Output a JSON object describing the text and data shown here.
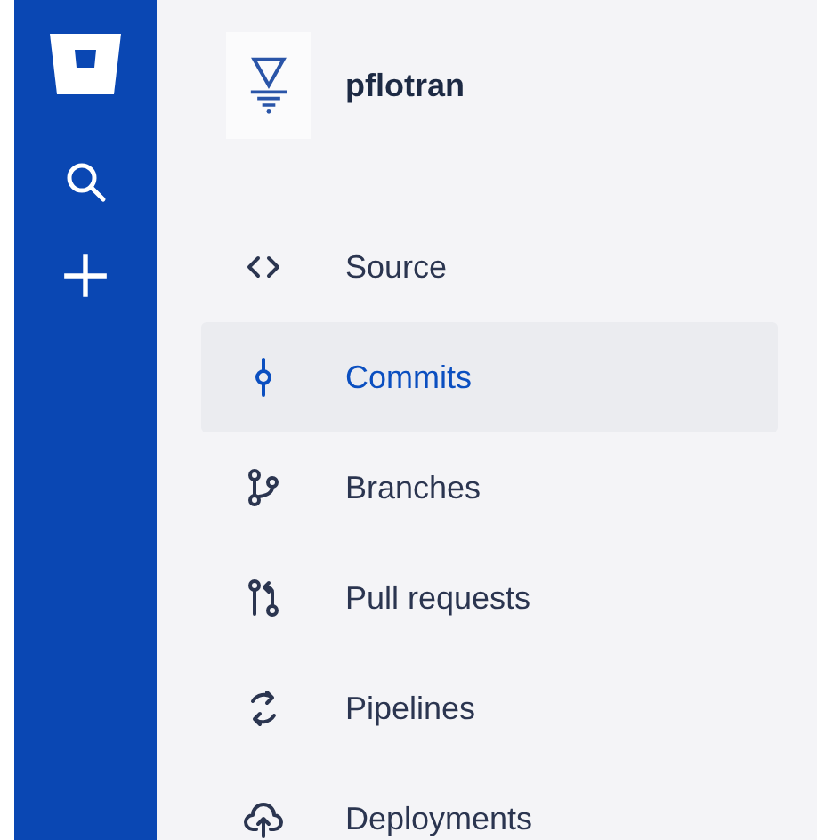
{
  "repository": {
    "name": "pflotran"
  },
  "nav_items": [
    {
      "label": "Source",
      "kind": "source",
      "selected": false
    },
    {
      "label": "Commits",
      "kind": "commits",
      "selected": true
    },
    {
      "label": "Branches",
      "kind": "branches",
      "selected": false
    },
    {
      "label": "Pull requests",
      "kind": "pull-requests",
      "selected": false
    },
    {
      "label": "Pipelines",
      "kind": "pipelines",
      "selected": false
    },
    {
      "label": "Deployments",
      "kind": "deployments",
      "selected": false
    }
  ]
}
